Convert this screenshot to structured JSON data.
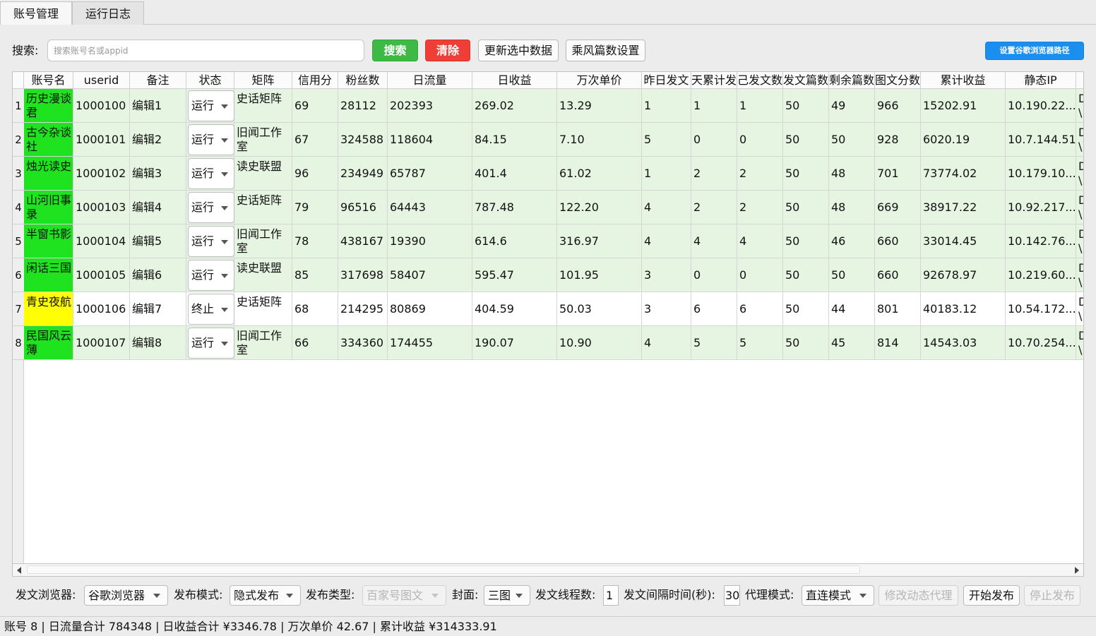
{
  "tabs": [
    {
      "label": "账号管理",
      "active": true
    },
    {
      "label": "运行日志",
      "active": false
    }
  ],
  "search": {
    "label": "搜索:",
    "placeholder": "搜索账号名或appid",
    "search_btn": "搜索",
    "clear_btn": "清除",
    "update_btn": "更新选中数据",
    "chengfeng_btn": "乘风篇数设置",
    "chrome_path_btn": "设置谷歌浏览器路径"
  },
  "colors": {
    "green_btn": "#3cba45",
    "red_btn": "#ee3e36",
    "blue_btn": "#1a8ff0",
    "row_green": "#e5f5e1",
    "name_green": "#1ee31e",
    "name_yellow": "#ffff00"
  },
  "table": {
    "headers": [
      "账号名",
      "userid",
      "备注",
      "状态",
      "矩阵",
      "信用分",
      "粉丝数",
      "日流量",
      "日收益",
      "万次单价",
      "昨日发文",
      "天累计发",
      "己发文数",
      "发文篇数",
      "剩余篇数",
      "图文分数",
      "累计收益",
      "静态IP",
      ""
    ],
    "rows": [
      {
        "num": "1",
        "name": "历史漫谈君",
        "userid": "1000100",
        "note": "编辑1",
        "status": "运行",
        "matrix": "史话矩阵",
        "credit": "69",
        "fans": "28112",
        "traffic": "202393",
        "income": "269.02",
        "unit": "13.29",
        "yday": "1",
        "cum": "1",
        "done": "1",
        "posts": "50",
        "remain": "49",
        "score": "966",
        "total": "15202.91",
        "ip": "10.190.22...",
        "extra": "D\\",
        "running": true,
        "name_color": "green"
      },
      {
        "num": "2",
        "name": "古今杂谈社",
        "userid": "1000101",
        "note": "编辑2",
        "status": "运行",
        "matrix": "旧闻工作室",
        "credit": "67",
        "fans": "324588",
        "traffic": "118604",
        "income": "84.15",
        "unit": "7.10",
        "yday": "5",
        "cum": "0",
        "done": "0",
        "posts": "50",
        "remain": "50",
        "score": "928",
        "total": "6020.19",
        "ip": "10.7.144.51",
        "extra": "D\\",
        "running": true,
        "name_color": "green"
      },
      {
        "num": "3",
        "name": "烛光读史",
        "userid": "1000102",
        "note": "编辑3",
        "status": "运行",
        "matrix": "读史联盟",
        "credit": "96",
        "fans": "234949",
        "traffic": "65787",
        "income": "401.4",
        "unit": "61.02",
        "yday": "1",
        "cum": "2",
        "done": "2",
        "posts": "50",
        "remain": "48",
        "score": "701",
        "total": "73774.02",
        "ip": "10.179.10...",
        "extra": "D\\",
        "running": true,
        "name_color": "green"
      },
      {
        "num": "4",
        "name": "山河旧事录",
        "userid": "1000103",
        "note": "编辑4",
        "status": "运行",
        "matrix": "史话矩阵",
        "credit": "79",
        "fans": "96516",
        "traffic": "64443",
        "income": "787.48",
        "unit": "122.20",
        "yday": "4",
        "cum": "2",
        "done": "2",
        "posts": "50",
        "remain": "48",
        "score": "669",
        "total": "38917.22",
        "ip": "10.92.217....",
        "extra": "D\\",
        "running": true,
        "name_color": "green"
      },
      {
        "num": "5",
        "name": "半窗书影",
        "userid": "1000104",
        "note": "编辑5",
        "status": "运行",
        "matrix": "旧闻工作室",
        "credit": "78",
        "fans": "438167",
        "traffic": "19390",
        "income": "614.6",
        "unit": "316.97",
        "yday": "4",
        "cum": "4",
        "done": "4",
        "posts": "50",
        "remain": "46",
        "score": "660",
        "total": "33014.45",
        "ip": "10.142.76....",
        "extra": "D\\",
        "running": true,
        "name_color": "green"
      },
      {
        "num": "6",
        "name": "闲话三国",
        "userid": "1000105",
        "note": "编辑6",
        "status": "运行",
        "matrix": "读史联盟",
        "credit": "85",
        "fans": "317698",
        "traffic": "58407",
        "income": "595.47",
        "unit": "101.95",
        "yday": "3",
        "cum": "0",
        "done": "0",
        "posts": "50",
        "remain": "50",
        "score": "660",
        "total": "92678.97",
        "ip": "10.219.60....",
        "extra": "D\\",
        "running": true,
        "name_color": "green"
      },
      {
        "num": "7",
        "name": "青史夜航",
        "userid": "1000106",
        "note": "编辑7",
        "status": "终止",
        "matrix": "史话矩阵",
        "credit": "68",
        "fans": "214295",
        "traffic": "80869",
        "income": "404.59",
        "unit": "50.03",
        "yday": "3",
        "cum": "6",
        "done": "6",
        "posts": "50",
        "remain": "44",
        "score": "801",
        "total": "40183.12",
        "ip": "10.54.172....",
        "extra": "D\\",
        "running": false,
        "name_color": "yellow"
      },
      {
        "num": "8",
        "name": "民国风云薄",
        "userid": "1000107",
        "note": "编辑8",
        "status": "运行",
        "matrix": "旧闻工作室",
        "credit": "66",
        "fans": "334360",
        "traffic": "174455",
        "income": "190.07",
        "unit": "10.90",
        "yday": "4",
        "cum": "5",
        "done": "5",
        "posts": "50",
        "remain": "45",
        "score": "814",
        "total": "14543.03",
        "ip": "10.70.254....",
        "extra": "D\\",
        "running": true,
        "name_color": "green"
      }
    ]
  },
  "bottom": {
    "browser_label": "发文浏览器:",
    "browser_value": "谷歌浏览器",
    "mode_label": "发布模式:",
    "mode_value": "隐式发布",
    "type_label": "发布类型:",
    "type_value": "百家号图文",
    "cover_label": "封面:",
    "cover_value": "三图",
    "threads_label": "发文线程数:",
    "threads_value": "1",
    "interval_label": "发文间隔时间(秒):",
    "interval_value": "30",
    "proxy_label": "代理模式:",
    "proxy_value": "直连模式",
    "edit_proxy_btn": "修改动态代理",
    "start_btn": "开始发布",
    "stop_btn": "停止发布"
  },
  "status": "账号 8 | 日流量合计 784348 | 日收益合计 ¥3346.78 | 万次单价 42.67 | 累计收益 ¥314333.91"
}
